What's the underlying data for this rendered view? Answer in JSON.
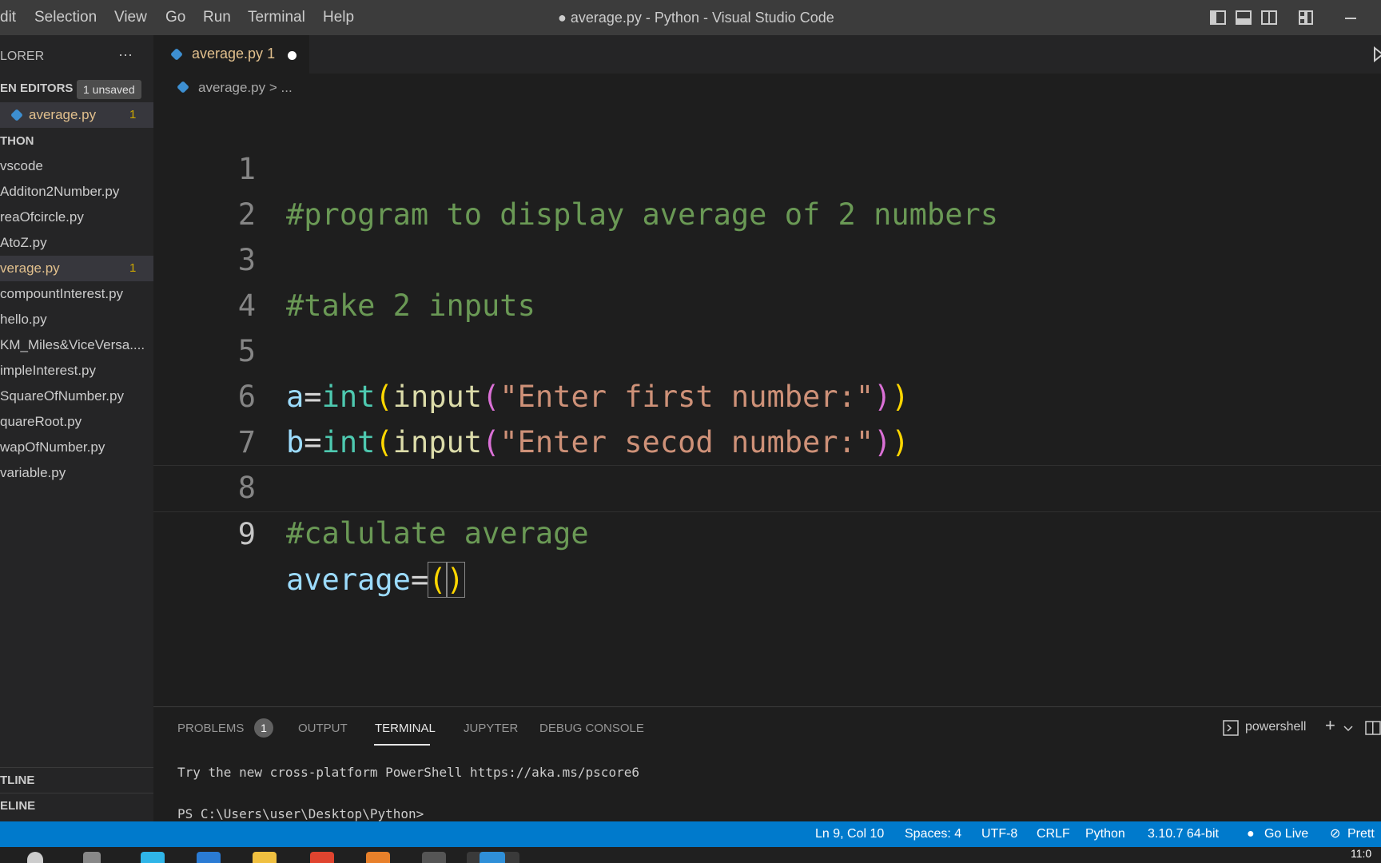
{
  "menu": [
    "dit",
    "Selection",
    "View",
    "Go",
    "Run",
    "Terminal",
    "Help"
  ],
  "window_title": "● average.py - Python - Visual Studio Code",
  "sidebar": {
    "title": "LORER",
    "more": "···",
    "open_editors_label": "EN EDITORS",
    "unsaved_badge": "1 unsaved",
    "open_editor": {
      "label": "average.py",
      "count": "1"
    },
    "folder_label": "THON",
    "files": [
      {
        "label": "vscode"
      },
      {
        "label": "Additon2Number.py"
      },
      {
        "label": "reaOfcircle.py"
      },
      {
        "label": "AtoZ.py"
      },
      {
        "label": "verage.py",
        "count": "1"
      },
      {
        "label": "compountInterest.py"
      },
      {
        "label": "hello.py"
      },
      {
        "label": "KM_Miles&ViceVersa...."
      },
      {
        "label": "impleInterest.py"
      },
      {
        "label": "SquareOfNumber.py"
      },
      {
        "label": "quareRoot.py"
      },
      {
        "label": "wapOfNumber.py"
      },
      {
        "label": "variable.py"
      }
    ],
    "outline_label": "TLINE",
    "timeline_label": "ELINE"
  },
  "tab": {
    "label": "average.py",
    "count": "1"
  },
  "breadcrumb": {
    "file": "average.py",
    "sep": "> ..."
  },
  "code": {
    "line_numbers": [
      "1",
      "2",
      "3",
      "4",
      "5",
      "6",
      "7",
      "8",
      "9"
    ],
    "line1": "#program to display average of 2 numbers",
    "line3": "#take 2 inputs",
    "line5": {
      "var": "a",
      "op": "=",
      "fn": "int",
      "fn2": "input",
      "str": "\"Enter first number:\""
    },
    "line6": {
      "var": "b",
      "op": "=",
      "fn": "int",
      "fn2": "input",
      "str": "\"Enter secod number:\""
    },
    "line8": "#calulate average",
    "line9": {
      "var": "average",
      "op": "="
    }
  },
  "panel": {
    "tabs": [
      "PROBLEMS",
      "OUTPUT",
      "TERMINAL",
      "JUPYTER",
      "DEBUG CONSOLE"
    ],
    "problems_count": "1",
    "shell": "powershell",
    "terminal_line1": "Try the new cross-platform PowerShell https://aka.ms/pscore6",
    "terminal_prompt": "PS C:\\Users\\user\\Desktop\\Python>"
  },
  "status": {
    "position": "Ln 9, Col 10",
    "spaces": "Spaces: 4",
    "encoding": "UTF-8",
    "eol": "CRLF",
    "language": "Python",
    "interpreter": "3.10.7 64-bit",
    "golive": "Go Live",
    "prettier": "Prett"
  },
  "taskbar": {
    "clock": "11:0"
  },
  "colors": {
    "status_bar": "#007acc",
    "comment": "#6a9955",
    "string": "#ce9178",
    "variable": "#9cdcfe",
    "builtin": "#4ec9b0",
    "function": "#dcdcaa",
    "modified_file": "#e2c08d"
  }
}
